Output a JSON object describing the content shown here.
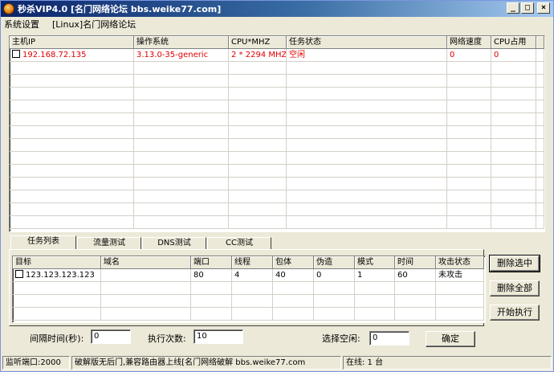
{
  "window": {
    "title": "秒杀VIP4.0 [名门网络论坛 bbs.weike77.com]",
    "min_label": "_",
    "max_label": "□",
    "close_label": "×"
  },
  "menu": {
    "items": [
      "系统设置",
      "[Linux]名门网络论坛"
    ]
  },
  "hosts": {
    "columns": [
      "主机IP",
      "操作系统",
      "CPU*MHZ",
      "任务状态",
      "网络速度",
      "CPU占用"
    ],
    "rows": [
      {
        "ip": "192.168.72.135",
        "os": "3.13.0-35-generic",
        "cpu": "2 * 2294 MHZ",
        "status": "空闲",
        "speed": "0",
        "cpu_usage": "0",
        "checked": false
      }
    ]
  },
  "tabs": {
    "items": [
      "任务列表",
      "流量测试",
      "DNS测试",
      "CC测试"
    ],
    "active": 0
  },
  "tasks": {
    "columns": [
      "目标",
      "域名",
      "端口",
      "线程",
      "包体",
      "伪造",
      "模式",
      "时间",
      "攻击状态"
    ],
    "rows": [
      {
        "target": "123.123.123.123",
        "domain": "",
        "port": "80",
        "threads": "4",
        "packet": "40",
        "spoof": "0",
        "mode": "1",
        "time": "60",
        "status": "未攻击",
        "checked": false
      }
    ]
  },
  "actions": {
    "delete_selected": "删除选中",
    "delete_all": "删除全部",
    "start": "开始执行"
  },
  "controls": {
    "interval_label": "间隔时间(秒):",
    "interval_value": "0",
    "count_label": "执行次数:",
    "count_value": "10",
    "idle_label": "选择空闲:",
    "idle_value": "0",
    "confirm": "确定"
  },
  "status": {
    "port": "监听端口:2000",
    "message": "破解版无后门,兼容路由器上线[名门网络破解 bbs.weike77.com",
    "online": "在线: 1 台"
  },
  "colors": {
    "accent_red": "#e00000",
    "title_dark": "#0a246a"
  }
}
